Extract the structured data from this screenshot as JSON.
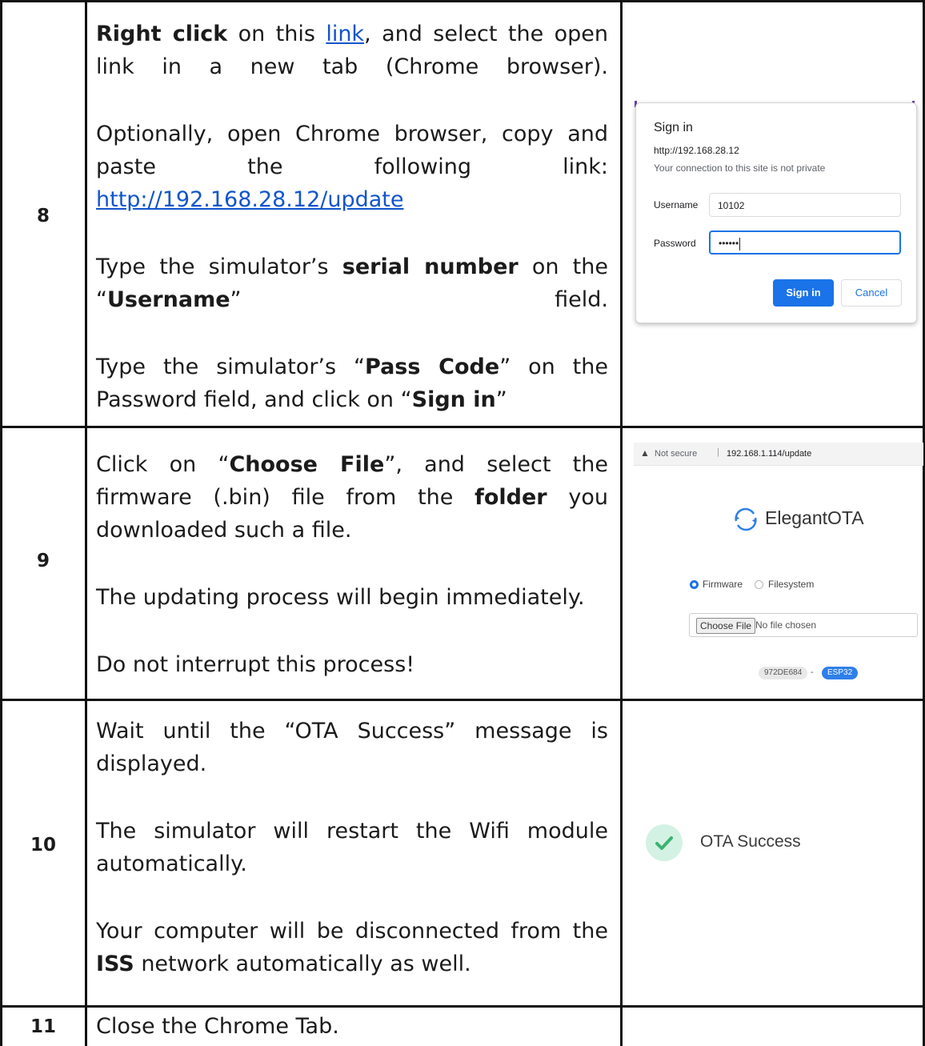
{
  "rows": [
    {
      "number": "8",
      "text": {
        "p1_bold": "Right click",
        "p1_a": " on this ",
        "p1_link": "link",
        "p1_b": ", and select the open link in a new tab (Chrome browser).",
        "p2": "Optionally, open Chrome browser, copy and paste the following link:",
        "p2_url": "http://192.168.28.12/update",
        "p3_a": "Type the simulator’s ",
        "p3_bold": "serial number",
        "p3_b": " on the “",
        "p3_bold2": "Username",
        "p3_c": "” field.",
        "p4_a": "Type the simulator’s “",
        "p4_bold": "Pass Code",
        "p4_b": "” on the Password field, and click on “",
        "p4_bold2": "Sign in",
        "p4_c": "”"
      },
      "signin_dialog": {
        "title": "Sign in",
        "host": "http://192.168.28.12",
        "note": "Your connection to this site is not private",
        "username_label": "Username",
        "username_value": "10102",
        "password_label": "Password",
        "password_value": "••••••",
        "signin_button": "Sign in",
        "cancel_button": "Cancel"
      }
    },
    {
      "number": "9",
      "text": {
        "p1_a": "Click on “",
        "p1_bold": "Choose File",
        "p1_b": "”, and select the firmware (.bin) file from the ",
        "p1_bold2": "folder",
        "p1_c": " you downloaded such a file.",
        "p2": "The updating process will begin immediately.",
        "p3": "Do not interrupt this process!"
      },
      "ota_page": {
        "not_secure": "Not secure",
        "separator": "|",
        "url": "192.168.1.114/update",
        "brand": "ElegantOTA",
        "radio_firmware": "Firmware",
        "radio_filesystem": "Filesystem",
        "choose_file": "Choose File",
        "no_file": "No file chosen",
        "hardware_id": "972DE684",
        "dash": "-",
        "chip": "ESP32"
      }
    },
    {
      "number": "10",
      "text": {
        "p1": "Wait until the “OTA Success” message is displayed.",
        "p2": "The simulator will restart the Wifi module automatically.",
        "p3_a": "Your computer will be disconnected from the ",
        "p3_bold": "ISS",
        "p3_b": " network automatically as well."
      },
      "success": {
        "label": "OTA Success"
      }
    },
    {
      "number": "11",
      "text": {
        "p1": "Close the Chrome Tab."
      }
    }
  ],
  "colors": {
    "link": "#1155cc",
    "primary": "#1a73e8",
    "success_bg": "#d3f2e3",
    "success_check": "#3cb371"
  }
}
